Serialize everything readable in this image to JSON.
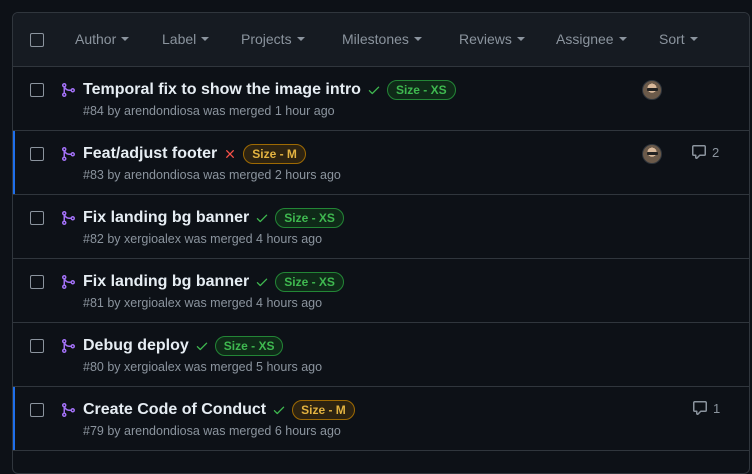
{
  "header": {
    "filters": [
      {
        "key": "author",
        "label": "Author"
      },
      {
        "key": "label",
        "label": "Label"
      },
      {
        "key": "projects",
        "label": "Projects"
      },
      {
        "key": "milestones",
        "label": "Milestones"
      },
      {
        "key": "reviews",
        "label": "Reviews"
      },
      {
        "key": "assignee",
        "label": "Assignee"
      },
      {
        "key": "sort",
        "label": "Sort"
      }
    ]
  },
  "colors": {
    "merged_icon": "#a371f7",
    "check": "#3fb950",
    "cross": "#f85149",
    "label_xs_text": "#3fb950",
    "label_xs_border": "#238636",
    "label_xs_bg": "#0f2a18",
    "label_m_text": "#e3b341",
    "label_m_border": "#9e6a03",
    "label_m_bg": "#2d2311",
    "unread_bar": "#1f6feb"
  },
  "pull_requests": [
    {
      "title": "Temporal fix to show the image intro",
      "status": "success",
      "label": "Size - XS",
      "label_kind": "xs",
      "number": "#84",
      "author": "arendondiosa",
      "merged": "was merged 1 hour ago",
      "avatar": true,
      "comments": "",
      "unread": false
    },
    {
      "title": "Feat/adjust footer",
      "status": "failure",
      "label": "Size - M",
      "label_kind": "m",
      "number": "#83",
      "author": "arendondiosa",
      "merged": "was merged 2 hours ago",
      "avatar": true,
      "comments": "2",
      "unread": true
    },
    {
      "title": "Fix landing bg banner",
      "status": "success",
      "label": "Size - XS",
      "label_kind": "xs",
      "number": "#82",
      "author": "xergioalex",
      "merged": "was merged 4 hours ago",
      "avatar": false,
      "comments": "",
      "unread": false
    },
    {
      "title": "Fix landing bg banner",
      "status": "success",
      "label": "Size - XS",
      "label_kind": "xs",
      "number": "#81",
      "author": "xergioalex",
      "merged": "was merged 4 hours ago",
      "avatar": false,
      "comments": "",
      "unread": false
    },
    {
      "title": "Debug deploy",
      "status": "success",
      "label": "Size - XS",
      "label_kind": "xs",
      "number": "#80",
      "author": "xergioalex",
      "merged": "was merged 5 hours ago",
      "avatar": false,
      "comments": "",
      "unread": false
    },
    {
      "title": "Create Code of Conduct",
      "status": "success",
      "label": "Size - M",
      "label_kind": "m",
      "number": "#79",
      "author": "arendondiosa",
      "merged": "was merged 6 hours ago",
      "avatar": false,
      "comments": "1",
      "unread": true
    }
  ]
}
